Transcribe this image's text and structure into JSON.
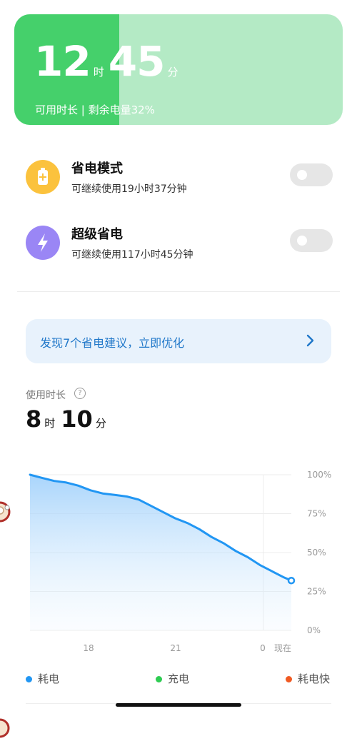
{
  "battery": {
    "hours": "12",
    "hours_unit": "时",
    "minutes": "45",
    "minutes_unit": "分",
    "subtitle": "可用时长 | 剩余电量32%",
    "level_percent": 32
  },
  "modes": [
    {
      "title": "省电模式",
      "desc": "可继续使用19小时37分钟",
      "icon": "battery-save-icon",
      "color": "#fbc23d",
      "enabled": false
    },
    {
      "title": "超级省电",
      "desc": "可继续使用117小时45分钟",
      "icon": "lightning-icon",
      "color": "#9a86f5",
      "enabled": false
    }
  ],
  "suggestion": {
    "text": "发现7个省电建议，立即优化",
    "arrow": "chevron-right-icon"
  },
  "usage": {
    "label": "使用时长",
    "hours": "8",
    "hours_unit": "时",
    "minutes": "10",
    "minutes_unit": "分"
  },
  "chart_data": {
    "type": "area",
    "x_ticks": [
      "18",
      "21",
      "0",
      "现在"
    ],
    "y_ticks": [
      "100%",
      "75%",
      "50%",
      "25%",
      "0%"
    ],
    "ylim": [
      0,
      100
    ],
    "series": [
      {
        "points": [
          [
            0,
            100
          ],
          [
            0.05,
            98
          ],
          [
            0.1,
            96
          ],
          [
            0.15,
            95
          ],
          [
            0.2,
            93
          ],
          [
            0.25,
            90
          ],
          [
            0.3,
            88
          ],
          [
            0.35,
            87
          ],
          [
            0.4,
            86
          ],
          [
            0.45,
            84
          ],
          [
            0.5,
            80
          ],
          [
            0.55,
            76
          ],
          [
            0.6,
            72
          ],
          [
            0.65,
            69
          ],
          [
            0.7,
            65
          ],
          [
            0.75,
            60
          ],
          [
            0.8,
            56
          ],
          [
            0.85,
            51
          ],
          [
            0.9,
            47
          ],
          [
            0.95,
            42
          ],
          [
            1.0,
            38
          ],
          [
            1.05,
            34
          ],
          [
            1.08,
            32
          ]
        ]
      }
    ],
    "legend": [
      {
        "label": "耗电",
        "color": "#2196f3"
      },
      {
        "label": "充电",
        "color": "#2ecc52"
      },
      {
        "label": "耗电快",
        "color": "#f05a22"
      }
    ]
  }
}
